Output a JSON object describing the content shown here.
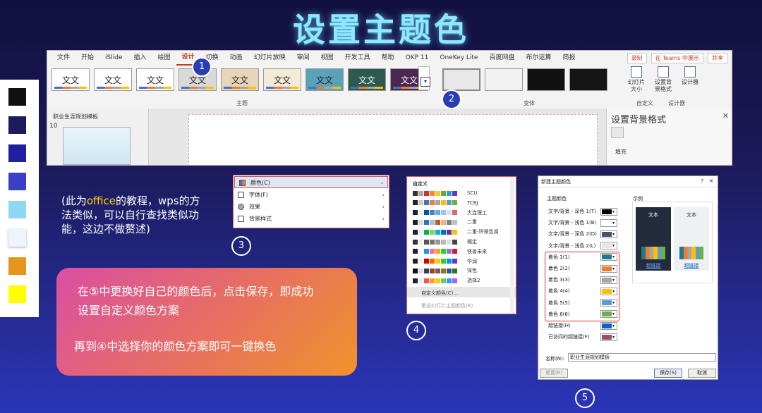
{
  "title": "设置主题色",
  "ribbon": {
    "tabs": [
      "文件",
      "开始",
      "iSlide",
      "插入",
      "绘图",
      "设计",
      "切换",
      "动画",
      "幻灯片放映",
      "审阅",
      "视图",
      "开发工具",
      "帮助",
      "OKP 11",
      "OneKey Lite",
      "百度网盘",
      "布尔运算",
      "简报"
    ],
    "active_tab": "设计",
    "right_buttons": [
      "录制",
      "在 Teams 中展示",
      "共享"
    ],
    "theme_label": "文文",
    "group_themes": "主题",
    "group_variants": "变体",
    "group_custom": "自定义",
    "group_designer": "设计器",
    "cmd_slide_size": "幻灯片大小",
    "cmd_bg_format": "设置背景格式",
    "cmd_designer": "设计器",
    "outline_title": "职业生涯规划模板",
    "slide_no": "10",
    "format_pane_title": "设置背景格式",
    "fill_label": "填充"
  },
  "palette": {
    "colors": [
      "#111111",
      "#1b1b5e",
      "#1f1fa0",
      "#3b3fc8",
      "#8fd8f3",
      "#eef4fb",
      "#e8951e",
      "#ffff00"
    ]
  },
  "note": {
    "pre": "(此为",
    "highlight": "office",
    "post": "的教程，wps的方法类似，可以自行查找类似功能，这边不做赘述)"
  },
  "tip": {
    "line1": "在⑤中更换好自己的颜色后，点击保存，即成功",
    "line2": "设置自定义颜色方案",
    "line3": "再到④中选择你的颜色方案即可一键换色"
  },
  "menu3": {
    "items": [
      "颜色(C)",
      "字体(F)",
      "效果",
      "背景样式"
    ]
  },
  "list4": {
    "header": "自定义",
    "schemes": [
      "SCU",
      "TCBJ",
      "大连理工",
      "二重",
      "二重-环保色调",
      "橘定",
      "怪兽未来",
      "华润",
      "深色",
      "选择2"
    ],
    "footer1": "自定义颜色(C)...",
    "footer2": "重设幻灯片主题颜色(R)"
  },
  "dlg5": {
    "title": "新建主题颜色",
    "section": "主题颜色",
    "example": "示例",
    "rows": [
      {
        "label": "文字/背景 - 深色 1(T)",
        "color": "#000000"
      },
      {
        "label": "文字/背景 - 浅色 1(B)",
        "color": "#ffffff"
      },
      {
        "label": "文字/背景 - 深色 2(D)",
        "color": "#44546a"
      },
      {
        "label": "文字/背景 - 浅色 2(L)",
        "color": "#e7e6e6"
      },
      {
        "label": "着色 1(1)",
        "color": "#1f7a8c"
      },
      {
        "label": "着色 2(2)",
        "color": "#ed7d31"
      },
      {
        "label": "着色 3(3)",
        "color": "#a5a5a5"
      },
      {
        "label": "着色 4(4)",
        "color": "#ffc000"
      },
      {
        "label": "着色 5(5)",
        "color": "#5b9bd5"
      },
      {
        "label": "着色 6(6)",
        "color": "#70ad47"
      },
      {
        "label": "超链接(H)",
        "color": "#0563c1"
      },
      {
        "label": "已访问的超链接(F)",
        "color": "#954f72"
      }
    ],
    "preview_text": "文本",
    "hyperlink": "超链接",
    "name_label": "名称(N):",
    "name_value": "职业生涯规划模板",
    "reset": "重置(R)",
    "save": "保存(S)",
    "cancel": "取消"
  },
  "steps": [
    "1",
    "2",
    "3",
    "4",
    "5"
  ]
}
